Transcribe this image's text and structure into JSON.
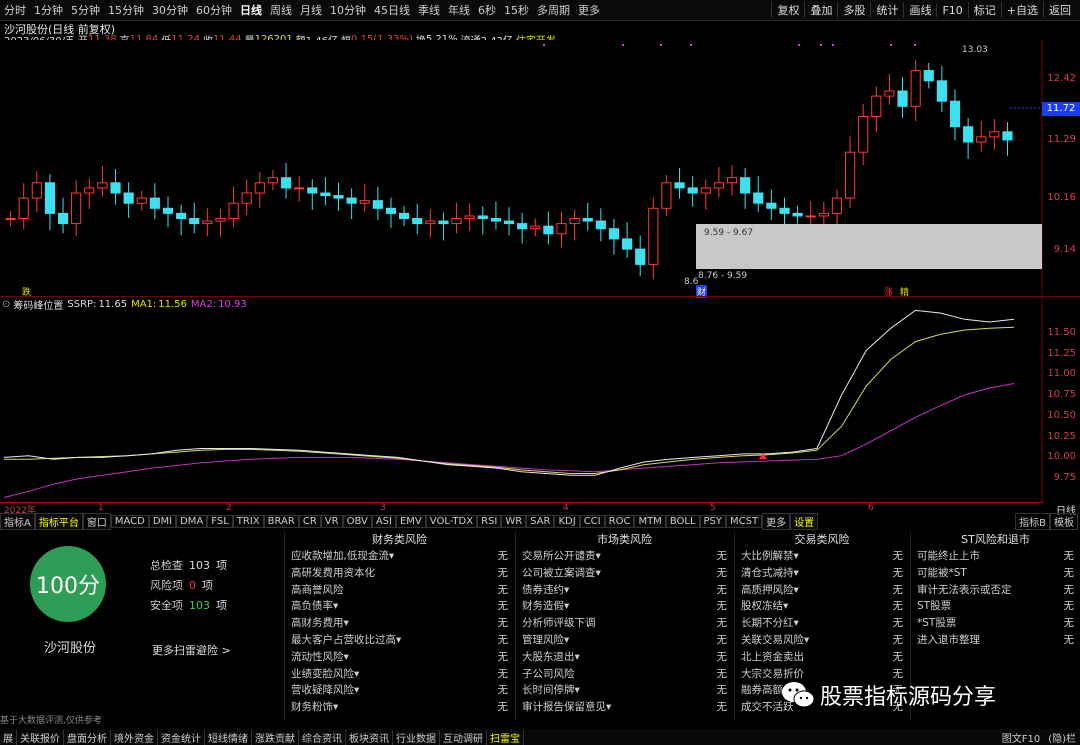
{
  "toolbar": {
    "periods": [
      "分时",
      "1分钟",
      "5分钟",
      "15分钟",
      "30分钟",
      "60分钟",
      "日线",
      "周线",
      "月线",
      "10分钟",
      "45日线",
      "季线",
      "年线",
      "6秒",
      "15秒",
      "多周期",
      "更多"
    ],
    "active": "日线",
    "right": [
      "复权",
      "叠加",
      "多股",
      "统计",
      "画线",
      "F10",
      "标记",
      "+自选",
      "返回"
    ]
  },
  "stock": {
    "name": "沙河股份(日线 前复权)",
    "date": "2023/06/30/五",
    "open_label": "开",
    "open": "11.38",
    "high_label": "高",
    "high": "11.84",
    "low_label": "低",
    "low": "11.24",
    "close_label": "收",
    "close": "11.44",
    "vol_label": "量",
    "vol": "126201",
    "amount_label": "额",
    "amount": "1.46亿",
    "chg_label": "幅",
    "chg": "0.15(1.33%)",
    "turnover_label": "换",
    "turnover": "5.21%",
    "float_label": "流通",
    "float": "2.42亿",
    "sector": "住宅开发"
  },
  "price_axis": {
    "labels": [
      "12.42",
      "11.29",
      "10.16",
      "9.14"
    ],
    "current": "11.72",
    "high_mark": "13.03",
    "low_mark": "8.6"
  },
  "annotations": {
    "range1": "9.59 - 9.67",
    "range2": "8.76 - 9.59",
    "marker_die": "跌",
    "marker_cai": "财",
    "marker_zhang": "涨",
    "marker_jing": "精"
  },
  "indicator": {
    "name": "筹码峰位置",
    "ssrp_label": "SSRP:",
    "ssrp": "11.65",
    "ma1_label": "MA1:",
    "ma1": "11.56",
    "ma2_label": "MA2:",
    "ma2": "10.93",
    "scale": [
      "11.50",
      "11.25",
      "11.00",
      "10.75",
      "10.50",
      "10.25",
      "10.00",
      "9.75"
    ]
  },
  "date_axis": {
    "year": "2022年",
    "months": [
      "1",
      "2",
      "3",
      "4",
      "5",
      "6"
    ],
    "right": "日线"
  },
  "indicator_tabs": [
    "指标A",
    "指标平台",
    "窗口",
    "MACD",
    "DMI",
    "DMA",
    "FSL",
    "TRIX",
    "BRAR",
    "CR",
    "VR",
    "OBV",
    "ASI",
    "EMV",
    "VOL-TDX",
    "RSI",
    "WR",
    "SAR",
    "KDJ",
    "CCI",
    "ROC",
    "MTM",
    "BOLL",
    "PSY",
    "MCST",
    "更多",
    "设置"
  ],
  "indicator_tabs_right": [
    "指标B",
    "模板"
  ],
  "panel": {
    "score": "100分",
    "stock_name": "沙河股份",
    "total_label": "总检查",
    "total": "103",
    "total_unit": "项",
    "risk_label": "风险项",
    "risk": "0",
    "risk_unit": "项",
    "safe_label": "安全项",
    "safe": "103",
    "safe_unit": "项",
    "more": "更多扫雷避险 >",
    "footnote": "基于大数据评测,仅供参考",
    "watermark": "股票指标源码分享",
    "columns": [
      {
        "title": "财务类风险",
        "items": [
          "应收款增加,低现金流▾",
          "高研发费用资本化",
          "高商誉风险",
          "高负债率▾",
          "高财务费用▾",
          "最大客户占营收比过高▾",
          "流动性风险▾",
          "业绩变脸风险▾",
          "营收疑降风险▾",
          "财务粉饰▾"
        ]
      },
      {
        "title": "市场类风险",
        "items": [
          "交易所公开谴责▾",
          "公司被立案调查▾",
          "债券违约▾",
          "财务造假▾",
          "分析师评级下调",
          "管理风险▾",
          "大股东退出▾",
          "子公司风险",
          "长时间停牌▾",
          "审计报告保留意见▾"
        ]
      },
      {
        "title": "交易类风险",
        "items": [
          "大比例解禁▾",
          "清仓式减持▾",
          "高质押风险▾",
          "股权冻结▾",
          "长期不分红▾",
          "关联交易风险▾",
          "北上资金卖出",
          "大宗交易折价",
          "融券高额",
          "成交不活跃"
        ]
      },
      {
        "title": "ST风险和退市",
        "items": [
          "可能终止上市",
          "可能被*ST",
          "审计无法表示或否定",
          "ST股票",
          "*ST股票",
          "进入退市整理"
        ]
      }
    ],
    "none": "无"
  },
  "bottom_tabs": [
    "展",
    "关联报价",
    "盘面分析",
    "境外资金",
    "资金统计",
    "短线情绪",
    "涨跌贡献",
    "综合资讯",
    "板块资讯",
    "行业数据",
    "互动调研",
    "扫雷宝"
  ],
  "bottom_right": "图文F10",
  "bottom_right2": "(隐)栏"
}
